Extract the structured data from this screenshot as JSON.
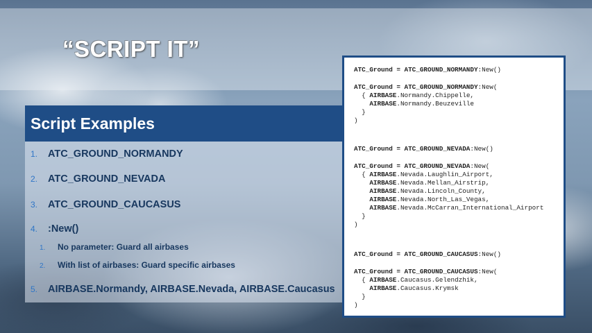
{
  "slide": {
    "title": "“SCRIPT IT”"
  },
  "section": {
    "header": "Script Examples"
  },
  "list": {
    "items": [
      {
        "num": "1.",
        "text": "ATC_GROUND_NORMANDY"
      },
      {
        "num": "2.",
        "text": "ATC_GROUND_NEVADA"
      },
      {
        "num": "3.",
        "text": "ATC_GROUND_CAUCASUS"
      },
      {
        "num": "4.",
        "text": ":New()"
      },
      {
        "num": "1.",
        "text": "No parameter: Guard all airbases"
      },
      {
        "num": "2.",
        "text": "With list of airbases: Guard specific airbases"
      },
      {
        "num": "5.",
        "text": "AIRBASE.Normandy, AIRBASE.Nevada, AIRBASE.Caucasus"
      }
    ]
  },
  "code": {
    "lines": [
      {
        "bold": "ATC_Ground = ATC_GROUND_NORMANDY",
        "rest": ":New()"
      },
      {
        "bold": "ATC_Ground = ATC_GROUND_NORMANDY",
        "rest": ":New("
      },
      {
        "pre": "  { ",
        "bold": "AIRBASE",
        "rest": ".Normandy.Chippelle,"
      },
      {
        "pre": "    ",
        "bold": "AIRBASE",
        "rest": ".Normandy.Beuzeville"
      },
      {
        "pre": "  }",
        "bold": "",
        "rest": ""
      },
      {
        "pre": ")",
        "bold": "",
        "rest": ""
      },
      {
        "bold": "ATC_Ground = ATC_GROUND_NEVADA",
        "rest": ":New()"
      },
      {
        "bold": "ATC_Ground = ATC_GROUND_NEVADA",
        "rest": ":New("
      },
      {
        "pre": "  { ",
        "bold": "AIRBASE",
        "rest": ".Nevada.Laughlin_Airport,"
      },
      {
        "pre": "    ",
        "bold": "AIRBASE",
        "rest": ".Nevada.Mellan_Airstrip,"
      },
      {
        "pre": "    ",
        "bold": "AIRBASE",
        "rest": ".Nevada.Lincoln_County,"
      },
      {
        "pre": "    ",
        "bold": "AIRBASE",
        "rest": ".Nevada.North_Las_Vegas,"
      },
      {
        "pre": "    ",
        "bold": "AIRBASE",
        "rest": ".Nevada.McCarran_International_Airport"
      },
      {
        "pre": "  }",
        "bold": "",
        "rest": ""
      },
      {
        "pre": ")",
        "bold": "",
        "rest": ""
      },
      {
        "bold": "ATC_Ground = ATC_GROUND_CAUCASUS",
        "rest": ":New()"
      },
      {
        "bold": "ATC_Ground = ATC_GROUND_CAUCASUS",
        "rest": ":New("
      },
      {
        "pre": "  { ",
        "bold": "AIRBASE",
        "rest": ".Caucasus.Gelendzhik,"
      },
      {
        "pre": "    ",
        "bold": "AIRBASE",
        "rest": ".Caucasus.Krymsk"
      },
      {
        "pre": "  }",
        "bold": "",
        "rest": ""
      },
      {
        "pre": ")",
        "bold": "",
        "rest": ""
      }
    ]
  },
  "colors": {
    "header_bg": "#1f4d86",
    "number_blue": "#2e75c6",
    "list_text": "#17375e"
  }
}
